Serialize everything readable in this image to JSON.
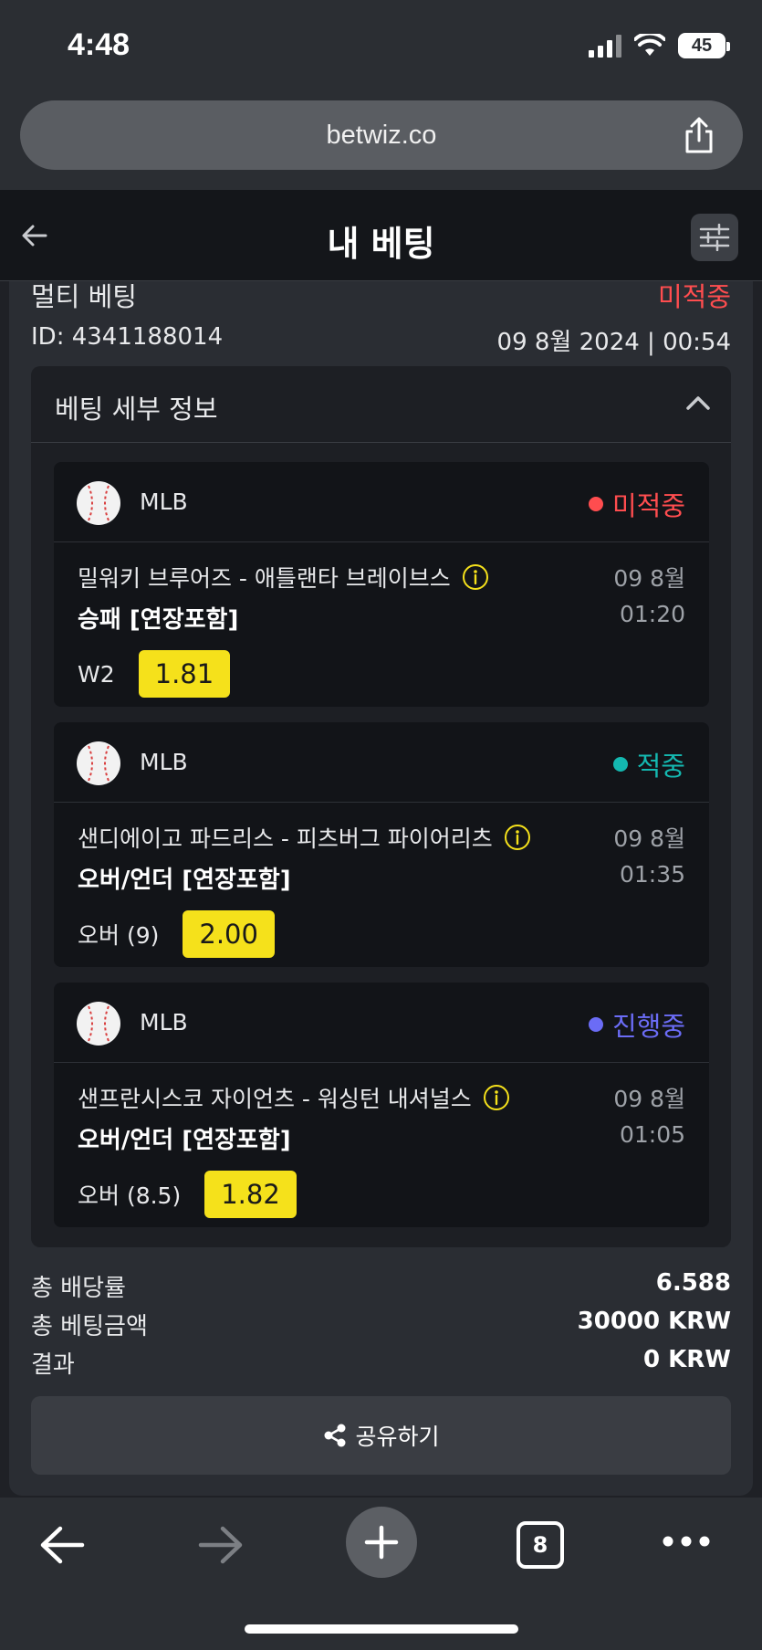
{
  "status_bar": {
    "time": "4:48",
    "battery": "45"
  },
  "browser": {
    "url": "betwiz.co"
  },
  "header": {
    "title": "내 베팅"
  },
  "bet": {
    "type": "멀티 베팅",
    "status": "미적중",
    "id": "ID: 4341188014",
    "datetime": "09 8월 2024 | 00:54",
    "details_title": "베팅 세부 정보",
    "events": [
      {
        "league": "MLB",
        "status": "미적중",
        "status_color": "#ff4d4f",
        "teams": "밀워키 브루어즈 - 애틀랜타 브레이브스",
        "market": "승패 [연장포함]",
        "date": "09 8월",
        "time": "01:20",
        "selection": "W2",
        "odds": "1.81"
      },
      {
        "league": "MLB",
        "status": "적중",
        "status_color": "#14b8b0",
        "teams": "샌디에이고 파드리스 - 피츠버그 파이어리츠",
        "market": "오버/언더 [연장포함]",
        "date": "09 8월",
        "time": "01:35",
        "selection": "오버 (9)",
        "odds": "2.00"
      },
      {
        "league": "MLB",
        "status": "진행중",
        "status_color": "#6b6cf6",
        "teams": "샌프란시스코 자이언츠 - 워싱턴 내셔널스",
        "market": "오버/언더 [연장포함]",
        "date": "09 8월",
        "time": "01:05",
        "selection": "오버 (8.5)",
        "odds": "1.82"
      }
    ],
    "summary": {
      "total_odds_label": "총 배당률",
      "total_odds": "6.588",
      "total_stake_label": "총 베팅금액",
      "total_stake": "30000 KRW",
      "result_label": "결과",
      "result": "0 KRW"
    },
    "share_label": "공유하기"
  },
  "bottom_bar": {
    "tabs_count": "8"
  },
  "icons": [
    "back-arrow-icon",
    "filter-icon",
    "chevron-up-icon",
    "baseball-icon",
    "info-icon",
    "share-icon",
    "plus-icon",
    "more-icon"
  ],
  "colors": {
    "accent_odds": "#f5e11b",
    "lost": "#ff4d4f",
    "won": "#14b8b0",
    "pending": "#6b6cf6"
  }
}
